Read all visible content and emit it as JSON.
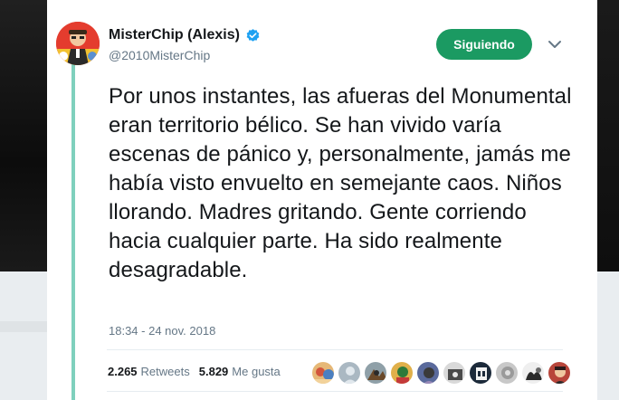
{
  "tweet": {
    "display_name": "MisterChip (Alexis)",
    "handle": "@2010MisterChip",
    "follow_label": "Siguiendo",
    "text": "Por unos instantes, las afueras del Monumental eran territorio bélico. Se han vivido varía escenas de pánico y, personalmente, jamás me había visto envuelto en semejante caos. Niños llorando. Madres gritando. Gente corriendo hacia cualquier parte. Ha sido realmente desagradable.",
    "timestamp": "18:34 - 24 nov. 2018",
    "retweets_count": "2.265",
    "retweets_label": "Retweets",
    "likes_count": "5.829",
    "likes_label": "Me gusta"
  },
  "colors": {
    "follow_button": "#1b9a62",
    "verified_badge": "#1da1f2",
    "thread_line": "#7fd0bd",
    "text_primary": "#14171a",
    "text_secondary": "#657786"
  },
  "liker_avatars": [
    {
      "icon": "liker-avatar-1",
      "color": "#d8a36a"
    },
    {
      "icon": "liker-avatar-2-default",
      "color": "#aab8c2"
    },
    {
      "icon": "liker-avatar-3",
      "color": "#8a6a3e"
    },
    {
      "icon": "liker-avatar-4",
      "color": "#d9a84a"
    },
    {
      "icon": "liker-avatar-5",
      "color": "#4a5a8c"
    },
    {
      "icon": "liker-avatar-6",
      "color": "#6c6c6c"
    },
    {
      "icon": "liker-avatar-7",
      "color": "#1c2a3a"
    },
    {
      "icon": "liker-avatar-8",
      "color": "#c8c8c8"
    },
    {
      "icon": "liker-avatar-9",
      "color": "#7a7a7a"
    },
    {
      "icon": "liker-avatar-10",
      "color": "#b8453a"
    }
  ]
}
